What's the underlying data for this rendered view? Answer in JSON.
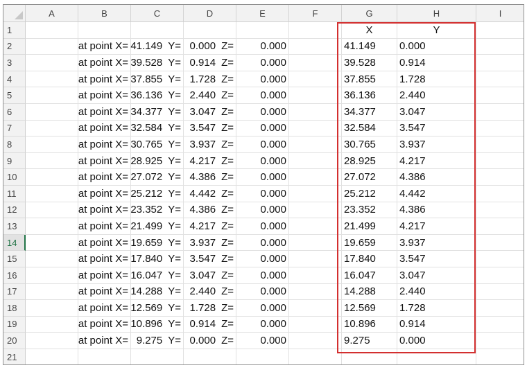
{
  "column_headers": [
    "A",
    "B",
    "C",
    "D",
    "E",
    "F",
    "G",
    "H",
    "I"
  ],
  "row_numbers": [
    "1",
    "2",
    "3",
    "4",
    "5",
    "6",
    "7",
    "8",
    "9",
    "10",
    "11",
    "12",
    "13",
    "14",
    "15",
    "16",
    "17",
    "18",
    "19",
    "20",
    "21"
  ],
  "active_row": "14",
  "header_row": {
    "G": "X",
    "H": "Y"
  },
  "rows": [
    {
      "B": "at point  X=",
      "C": "41.149",
      "D": "0.000",
      "E": "0.000",
      "G": "41.149",
      "H": "0.000"
    },
    {
      "B": "at point  X=",
      "C": "39.528",
      "D": "0.914",
      "E": "0.000",
      "G": "39.528",
      "H": "0.914"
    },
    {
      "B": "at point  X=",
      "C": "37.855",
      "D": "1.728",
      "E": "0.000",
      "G": "37.855",
      "H": "1.728"
    },
    {
      "B": "at point  X=",
      "C": "36.136",
      "D": "2.440",
      "E": "0.000",
      "G": "36.136",
      "H": "2.440"
    },
    {
      "B": "at point  X=",
      "C": "34.377",
      "D": "3.047",
      "E": "0.000",
      "G": "34.377",
      "H": "3.047"
    },
    {
      "B": "at point  X=",
      "C": "32.584",
      "D": "3.547",
      "E": "0.000",
      "G": "32.584",
      "H": "3.547"
    },
    {
      "B": "at point  X=",
      "C": "30.765",
      "D": "3.937",
      "E": "0.000",
      "G": "30.765",
      "H": "3.937"
    },
    {
      "B": "at point  X=",
      "C": "28.925",
      "D": "4.217",
      "E": "0.000",
      "G": "28.925",
      "H": "4.217"
    },
    {
      "B": "at point  X=",
      "C": "27.072",
      "D": "4.386",
      "E": "0.000",
      "G": "27.072",
      "H": "4.386"
    },
    {
      "B": "at point  X=",
      "C": "25.212",
      "D": "4.442",
      "E": "0.000",
      "G": "25.212",
      "H": "4.442"
    },
    {
      "B": "at point  X=",
      "C": "23.352",
      "D": "4.386",
      "E": "0.000",
      "G": "23.352",
      "H": "4.386"
    },
    {
      "B": "at point  X=",
      "C": "21.499",
      "D": "4.217",
      "E": "0.000",
      "G": "21.499",
      "H": "4.217"
    },
    {
      "B": "at point  X=",
      "C": "19.659",
      "D": "3.937",
      "E": "0.000",
      "G": "19.659",
      "H": "3.937"
    },
    {
      "B": "at point  X=",
      "C": "17.840",
      "D": "3.547",
      "E": "0.000",
      "G": "17.840",
      "H": "3.547"
    },
    {
      "B": "at point  X=",
      "C": "16.047",
      "D": "3.047",
      "E": "0.000",
      "G": "16.047",
      "H": "3.047"
    },
    {
      "B": "at point  X=",
      "C": "14.288",
      "D": "2.440",
      "E": "0.000",
      "G": "14.288",
      "H": "2.440"
    },
    {
      "B": "at point  X=",
      "C": "12.569",
      "D": "1.728",
      "E": "0.000",
      "G": "12.569",
      "H": "1.728"
    },
    {
      "B": "at point  X=",
      "C": "10.896",
      "D": "0.914",
      "E": "0.000",
      "G": "10.896",
      "H": "0.914"
    },
    {
      "B": "at point  X=",
      "C": "9.275",
      "D": "0.000",
      "E": "0.000",
      "G": "9.275",
      "H": "0.000"
    }
  ],
  "labels": {
    "C": "Y=",
    "D": "Z="
  },
  "colors": {
    "highlight_border": "#d32f2f",
    "active_row_header": "#217346"
  }
}
